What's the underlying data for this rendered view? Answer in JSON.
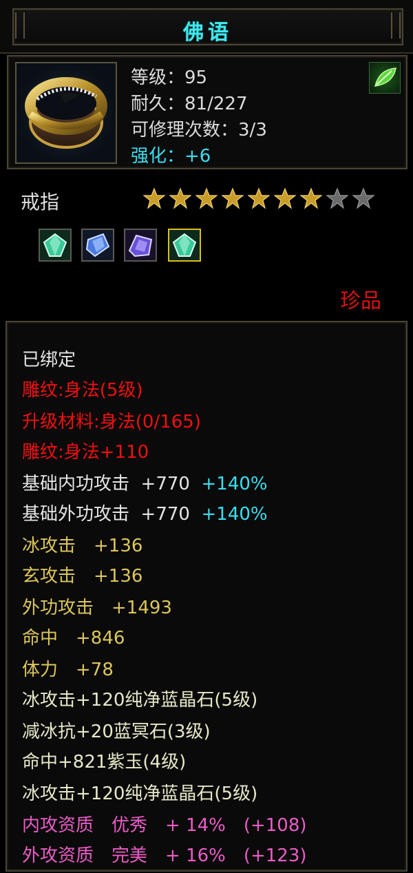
{
  "title": "佛语",
  "header": {
    "level_label": "等级：",
    "level_value": "95",
    "durability_label": "耐久：",
    "durability_value": "81/227",
    "repair_label": "可修理次数：",
    "repair_value": "3/3",
    "enhance_label": "强化：",
    "enhance_value": "+6"
  },
  "item_type": "戒指",
  "stars": {
    "filled": 7,
    "total": 9
  },
  "gems": [
    "green-diamond-gem-icon",
    "blue-crystal-gem-icon",
    "purple-crystal-gem-icon",
    "green-diamond-gem-icon"
  ],
  "rarity": "珍品",
  "description": {
    "bound": "已绑定",
    "engrave": "雕纹:身法(5级)",
    "upgrade_material": "升级材料:身法(0/165)",
    "engrave_bonus": "雕纹:身法+110",
    "inner_attack_label": "基础内功攻击",
    "inner_attack_value": "+770",
    "inner_attack_percent": "+140%",
    "outer_attack_label": "基础外功攻击",
    "outer_attack_value": "+770",
    "outer_attack_percent": "+140%",
    "ice_attack": "冰攻击　+136",
    "mystic_attack": "玄攻击　+136",
    "outer_attack": "外功攻击　+1493",
    "hit": "命中　+846",
    "stamina": "体力　+78",
    "gem_line_1": "冰攻击+120纯净蓝晶石(5级)",
    "gem_line_2": "减冰抗+20蓝冥石(3级)",
    "gem_line_3": "命中+821紫玉(4级)",
    "gem_line_4": "冰攻击+120纯净蓝晶石(5级)",
    "quality_inner": "内攻资质　优秀　+ 14%　(+108)",
    "quality_outer": "外攻资质　完美　+ 16%　(+123)"
  },
  "colors": {
    "title": "#40e8ee",
    "enhance": "#38e0f0",
    "red": "#f01010",
    "yellow": "#ddc75a",
    "pink": "#ec5cc8"
  }
}
